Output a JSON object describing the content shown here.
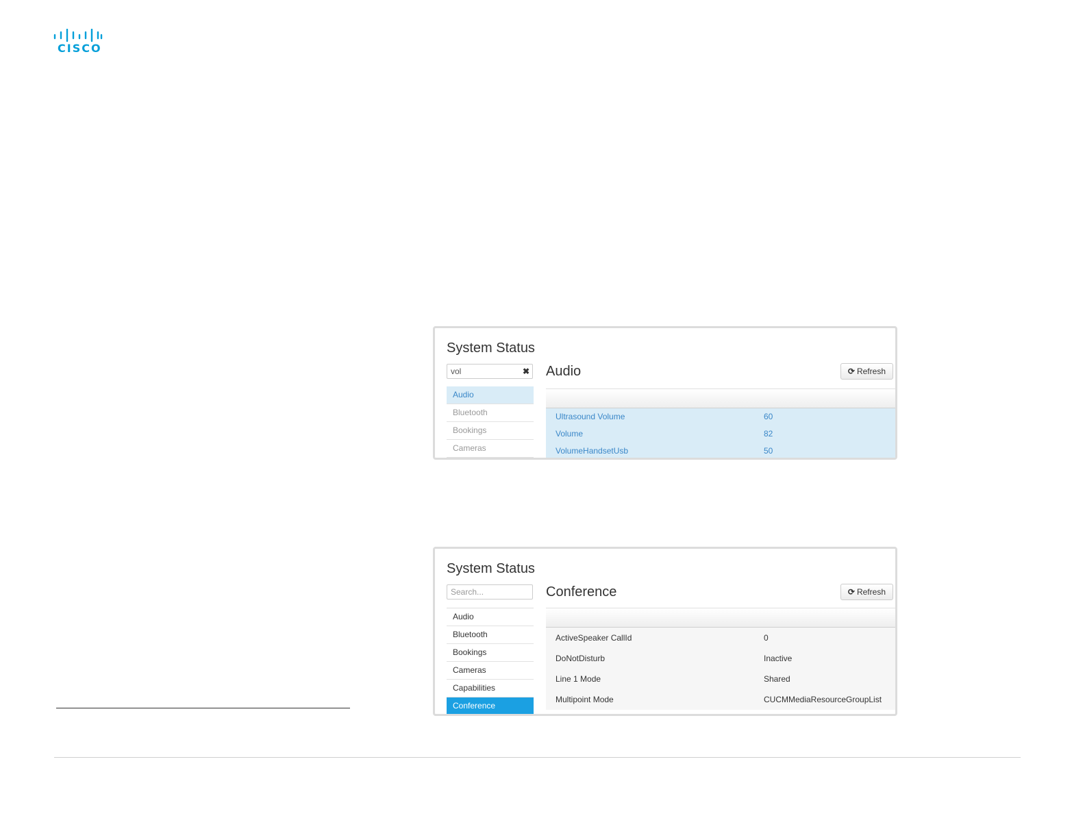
{
  "brand": {
    "name": "CISCO"
  },
  "panels": [
    {
      "title": "System Status",
      "search": {
        "value": "vol",
        "placeholder": ""
      },
      "sidebar": [
        {
          "label": "Audio",
          "active": true
        },
        {
          "label": "Bluetooth",
          "active": false
        },
        {
          "label": "Bookings",
          "active": false
        },
        {
          "label": "Cameras",
          "active": false
        }
      ],
      "section": "Audio",
      "refresh_label": "Refresh",
      "rows": [
        {
          "key": "Ultrasound Volume",
          "value": "60"
        },
        {
          "key": "Volume",
          "value": "82"
        },
        {
          "key": "VolumeHandsetUsb",
          "value": "50"
        }
      ]
    },
    {
      "title": "System Status",
      "search": {
        "value": "",
        "placeholder": "Search..."
      },
      "sidebar": [
        {
          "label": "Audio",
          "active": false
        },
        {
          "label": "Bluetooth",
          "active": false
        },
        {
          "label": "Bookings",
          "active": false
        },
        {
          "label": "Cameras",
          "active": false
        },
        {
          "label": "Capabilities",
          "active": false
        },
        {
          "label": "Conference",
          "active": true
        }
      ],
      "section": "Conference",
      "refresh_label": "Refresh",
      "rows": [
        {
          "key": "ActiveSpeaker CallId",
          "value": "0"
        },
        {
          "key": "DoNotDisturb",
          "value": "Inactive"
        },
        {
          "key": "Line 1 Mode",
          "value": "Shared"
        },
        {
          "key": "Multipoint Mode",
          "value": "CUCMMediaResourceGroupList"
        }
      ]
    }
  ],
  "colors": {
    "brand": "#049fd9",
    "active_highlight": "#1ba0e2",
    "filter_highlight": "#d9ecf7"
  }
}
